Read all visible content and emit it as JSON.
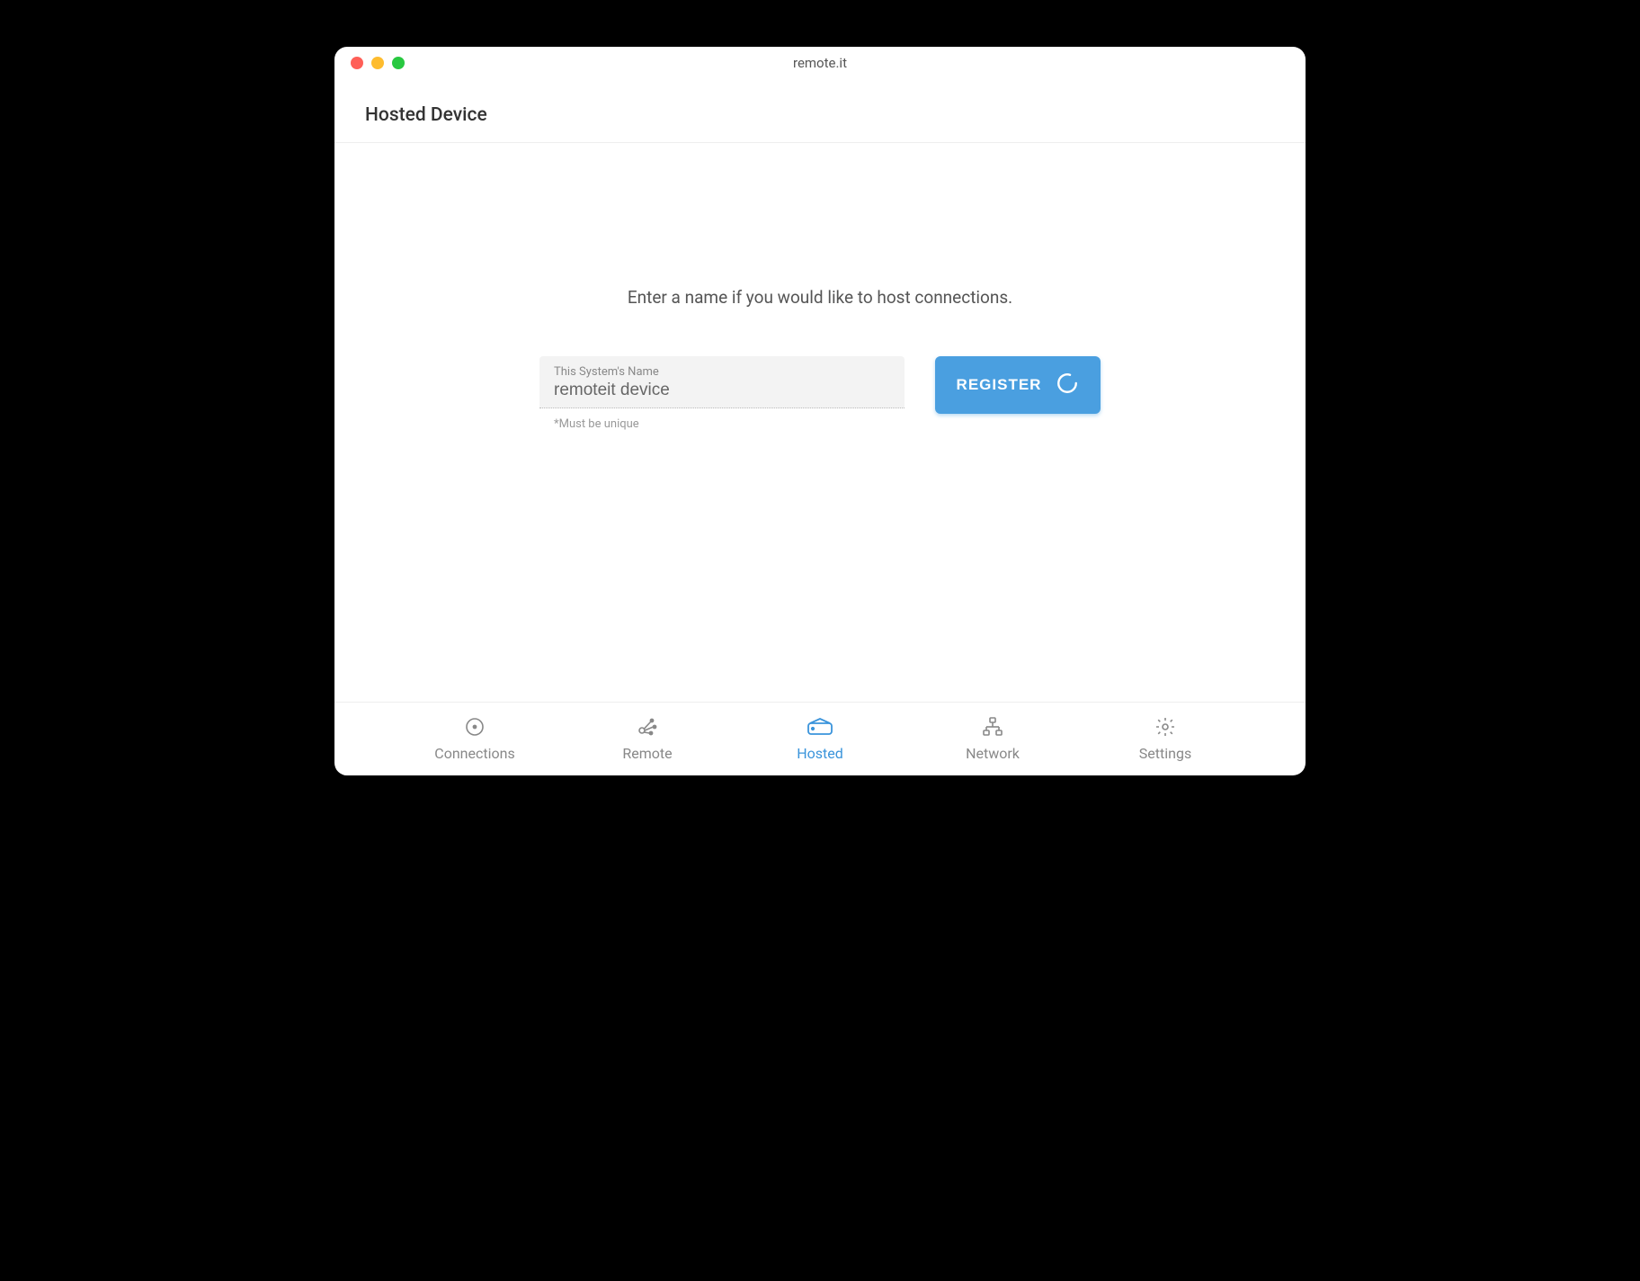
{
  "window": {
    "title": "remote.it"
  },
  "page": {
    "heading": "Hosted Device",
    "prompt": "Enter a name if you would like to host connections."
  },
  "form": {
    "name_field": {
      "label": "This System's Name",
      "value": "remoteit device",
      "helper": "*Must be unique"
    },
    "register_label": "REGISTER"
  },
  "nav": {
    "items": [
      {
        "label": "Connections",
        "active": false
      },
      {
        "label": "Remote",
        "active": false
      },
      {
        "label": "Hosted",
        "active": true
      },
      {
        "label": "Network",
        "active": false
      },
      {
        "label": "Settings",
        "active": false
      }
    ]
  },
  "colors": {
    "accent": "#4a9fe0"
  }
}
